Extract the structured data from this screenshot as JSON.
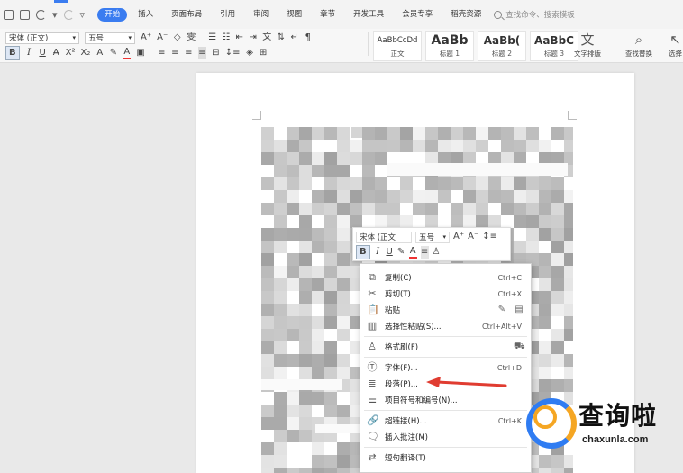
{
  "menubar": {
    "tabs": [
      "开始",
      "插入",
      "页面布局",
      "引用",
      "审阅",
      "视图",
      "章节",
      "开发工具",
      "会员专享",
      "稻壳资源"
    ],
    "active_tab": "开始",
    "search_placeholder": "查找命令、搜索模板"
  },
  "ribbon": {
    "font_name": "宋体 (正文)",
    "font_size": "五号",
    "styles": [
      {
        "sample": "AaBbCcDd",
        "name": "正文"
      },
      {
        "sample": "AaBb",
        "name": "标题 1"
      },
      {
        "sample": "AaBb(",
        "name": "标题 2"
      },
      {
        "sample": "AaBbC",
        "name": "标题 3"
      }
    ],
    "text_layout_label": "文字排版",
    "find_replace_label": "查找替换",
    "select_label": "选择"
  },
  "minibar": {
    "font_name": "宋体 (正文",
    "font_size": "五号"
  },
  "context_menu": {
    "items": [
      {
        "icon": "copy-icon",
        "label": "复制(C)",
        "shortcut": "Ctrl+C"
      },
      {
        "icon": "cut-icon",
        "label": "剪切(T)",
        "shortcut": "Ctrl+X"
      },
      {
        "icon": "paste-icon",
        "label": "粘贴",
        "shortcut": ""
      },
      {
        "icon": "paste-special-icon",
        "label": "选择性粘贴(S)...",
        "shortcut": "Ctrl+Alt+V"
      },
      {
        "icon": "format-painter-icon",
        "label": "格式刷(F)",
        "shortcut": ""
      },
      {
        "icon": "font-icon",
        "label": "字体(F)...",
        "shortcut": "Ctrl+D"
      },
      {
        "icon": "paragraph-icon",
        "label": "段落(P)...",
        "shortcut": ""
      },
      {
        "icon": "list-icon",
        "label": "项目符号和编号(N)...",
        "shortcut": ""
      },
      {
        "icon": "hyperlink-icon",
        "label": "超链接(H)...",
        "shortcut": "Ctrl+K"
      },
      {
        "icon": "comment-icon",
        "label": "插入批注(M)",
        "shortcut": ""
      },
      {
        "icon": "translate-icon",
        "label": "短句翻译(T)",
        "shortcut": ""
      }
    ]
  },
  "watermark": {
    "title": "查询啦",
    "url": "chaxunla.com"
  },
  "colors": {
    "accent": "#3a7cf0",
    "arrow": "#e03c31",
    "wm_blue": "#2f7cf2",
    "wm_orange": "#f5a623"
  }
}
